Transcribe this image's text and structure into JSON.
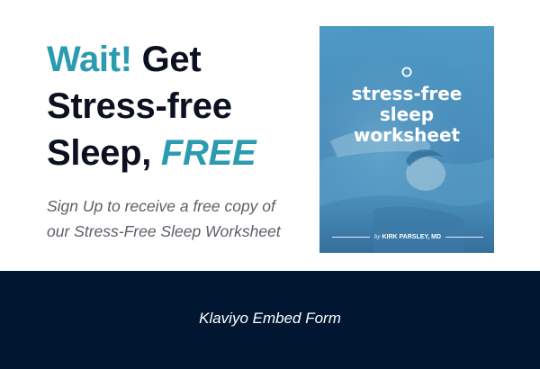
{
  "headline": {
    "wait": "Wait!",
    "get": " Get",
    "stress_free": "Stress-free",
    "sleep": "Sleep, ",
    "free": "FREE"
  },
  "subtext": {
    "line1": "Sign Up to receive a free copy of",
    "line2": "our Stress-Free Sleep Worksheet"
  },
  "cover": {
    "title_line1": "stress-free",
    "title_line2": "sleep",
    "title_line3": "worksheet",
    "by": "by",
    "author": "KIRK PARSLEY, MD",
    "logo_icon": "ring-logo-icon"
  },
  "form": {
    "placeholder_label": "Klaviyo Embed Form"
  },
  "colors": {
    "accent": "#2a9bb0",
    "headline_text": "#0b1120",
    "subtext": "#5b5f66",
    "form_band": "#001631",
    "cover_blue": "#4a8fbd"
  }
}
